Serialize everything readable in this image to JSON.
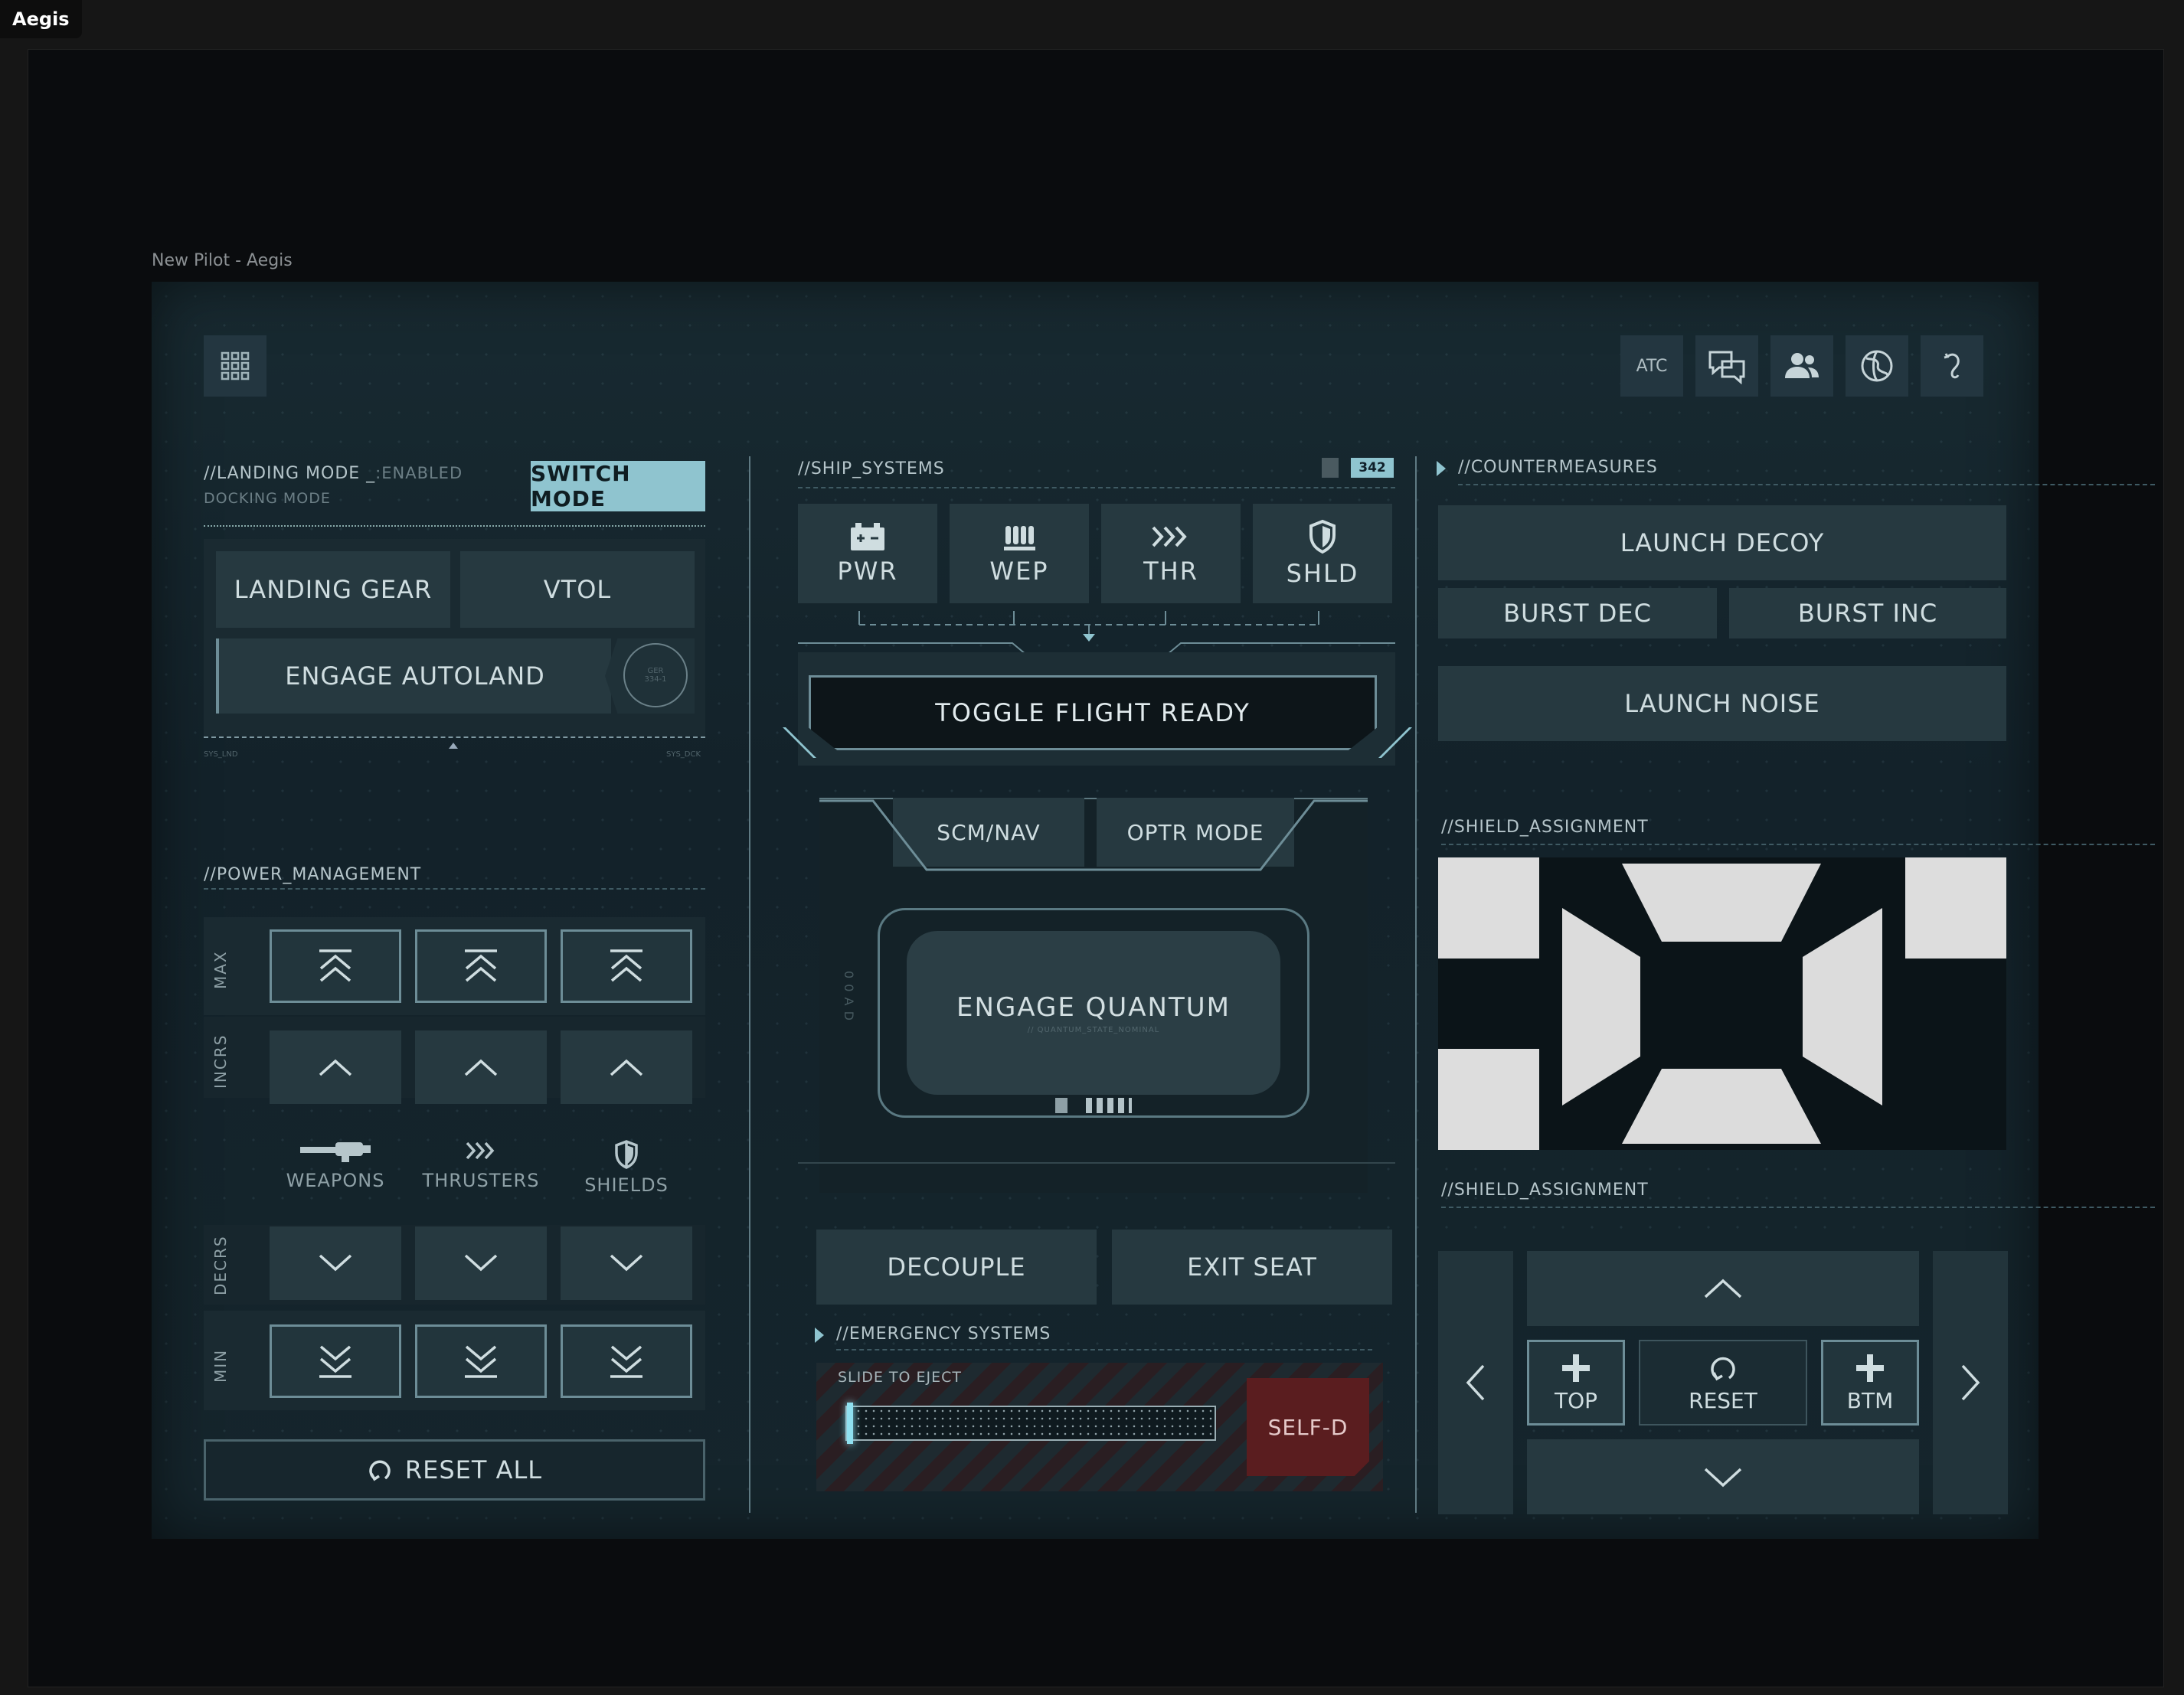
{
  "app": {
    "name": "Aegis"
  },
  "breadcrumb": "New Pilot -  Aegis",
  "topbar": {
    "atc": "ATC"
  },
  "landing": {
    "header": "//LANDING MODE _",
    "status": ":ENABLED",
    "sub": "DOCKING MODE",
    "switch": "SWITCH MODE",
    "gear": "LANDING GEAR",
    "vtol": "VTOL",
    "autoland": "ENGAGE AUTOLAND",
    "dial_line1": "GER",
    "dial_line2": "334-1",
    "foot_left": "SYS_LND",
    "foot_right": "SYS_DCK"
  },
  "power": {
    "header": "//POWER_MANAGEMENT",
    "rows": {
      "max": "MAX",
      "incrs": "INCRS",
      "decrs": "DECRS",
      "min": "MIN"
    },
    "categories": [
      "WEAPONS",
      "THRUSTERS",
      "SHIELDS"
    ],
    "reset_all": "RESET ALL"
  },
  "ship": {
    "header": "//SHIP_SYSTEMS",
    "counter": "342",
    "systems": [
      "PWR",
      "WEP",
      "THR",
      "SHLD"
    ],
    "flight_ready": "TOGGLE FLIGHT READY",
    "scm": "SCM/NAV",
    "optr": "OPTR MODE",
    "quantum": "ENGAGE QUANTUM",
    "quantum_sub": "// QUANTUM_STATE_NOMINAL",
    "side_text": "0 0    A D",
    "decouple": "DECOUPLE",
    "exit_seat": "EXIT SEAT"
  },
  "emergency": {
    "header": "//EMERGENCY SYSTEMS",
    "slide": "SLIDE TO EJECT",
    "selfd": "SELF-D"
  },
  "counter": {
    "header": "//COUNTERMEASURES",
    "launch_decoy": "LAUNCH DECOY",
    "burst_dec": "BURST DEC",
    "burst_inc": "BURST INC",
    "launch_noise": "LAUNCH NOISE"
  },
  "shield1": {
    "header": "//SHIELD_ASSIGNMENT"
  },
  "shield2": {
    "header": "//SHIELD_ASSIGNMENT",
    "top": "TOP",
    "reset": "RESET",
    "btm": "BTM"
  },
  "colors": {
    "accent": "#8fc9d6",
    "panel": "#15232a",
    "button": "#263940",
    "danger": "#5a1d1f"
  }
}
